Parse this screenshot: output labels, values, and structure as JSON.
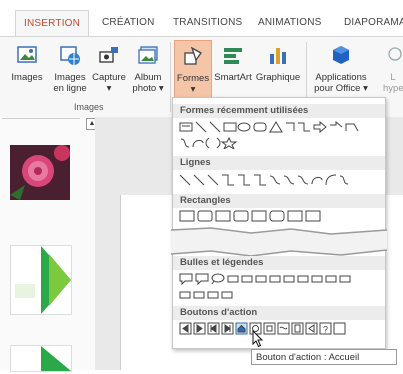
{
  "tabs": [
    "INSERTION",
    "CRÉATION",
    "TRANSITIONS",
    "ANIMATIONS",
    "DIAPORAMA"
  ],
  "ribbon": {
    "images_label": "Images",
    "images_en_ligne_line1": "Images",
    "images_en_ligne_line2": "en ligne",
    "capture_line1": "Capture",
    "capture_line2": "▾",
    "album_line1": "Album",
    "album_line2": "photo ▾",
    "group_images": "Images",
    "formes_line1": "Formes",
    "formes_line2": "▾",
    "smartart": "SmartArt",
    "graphique": "Graphique",
    "applications_line1": "Applications",
    "applications_line2": "pour Office ▾",
    "cut_line1": "L",
    "cut_line2": "hype"
  },
  "dropdown": {
    "recent_header": "Formes récemment utilisées",
    "lines_header": "Lignes",
    "rect_header": "Rectangles",
    "callouts_header": "Bulles et légendes",
    "actions_header": "Boutons d'action"
  },
  "tooltip": "Bouton d'action : Accueil",
  "colors": {
    "accent": "#c8482a",
    "formes_bg": "#f5c5a8"
  }
}
